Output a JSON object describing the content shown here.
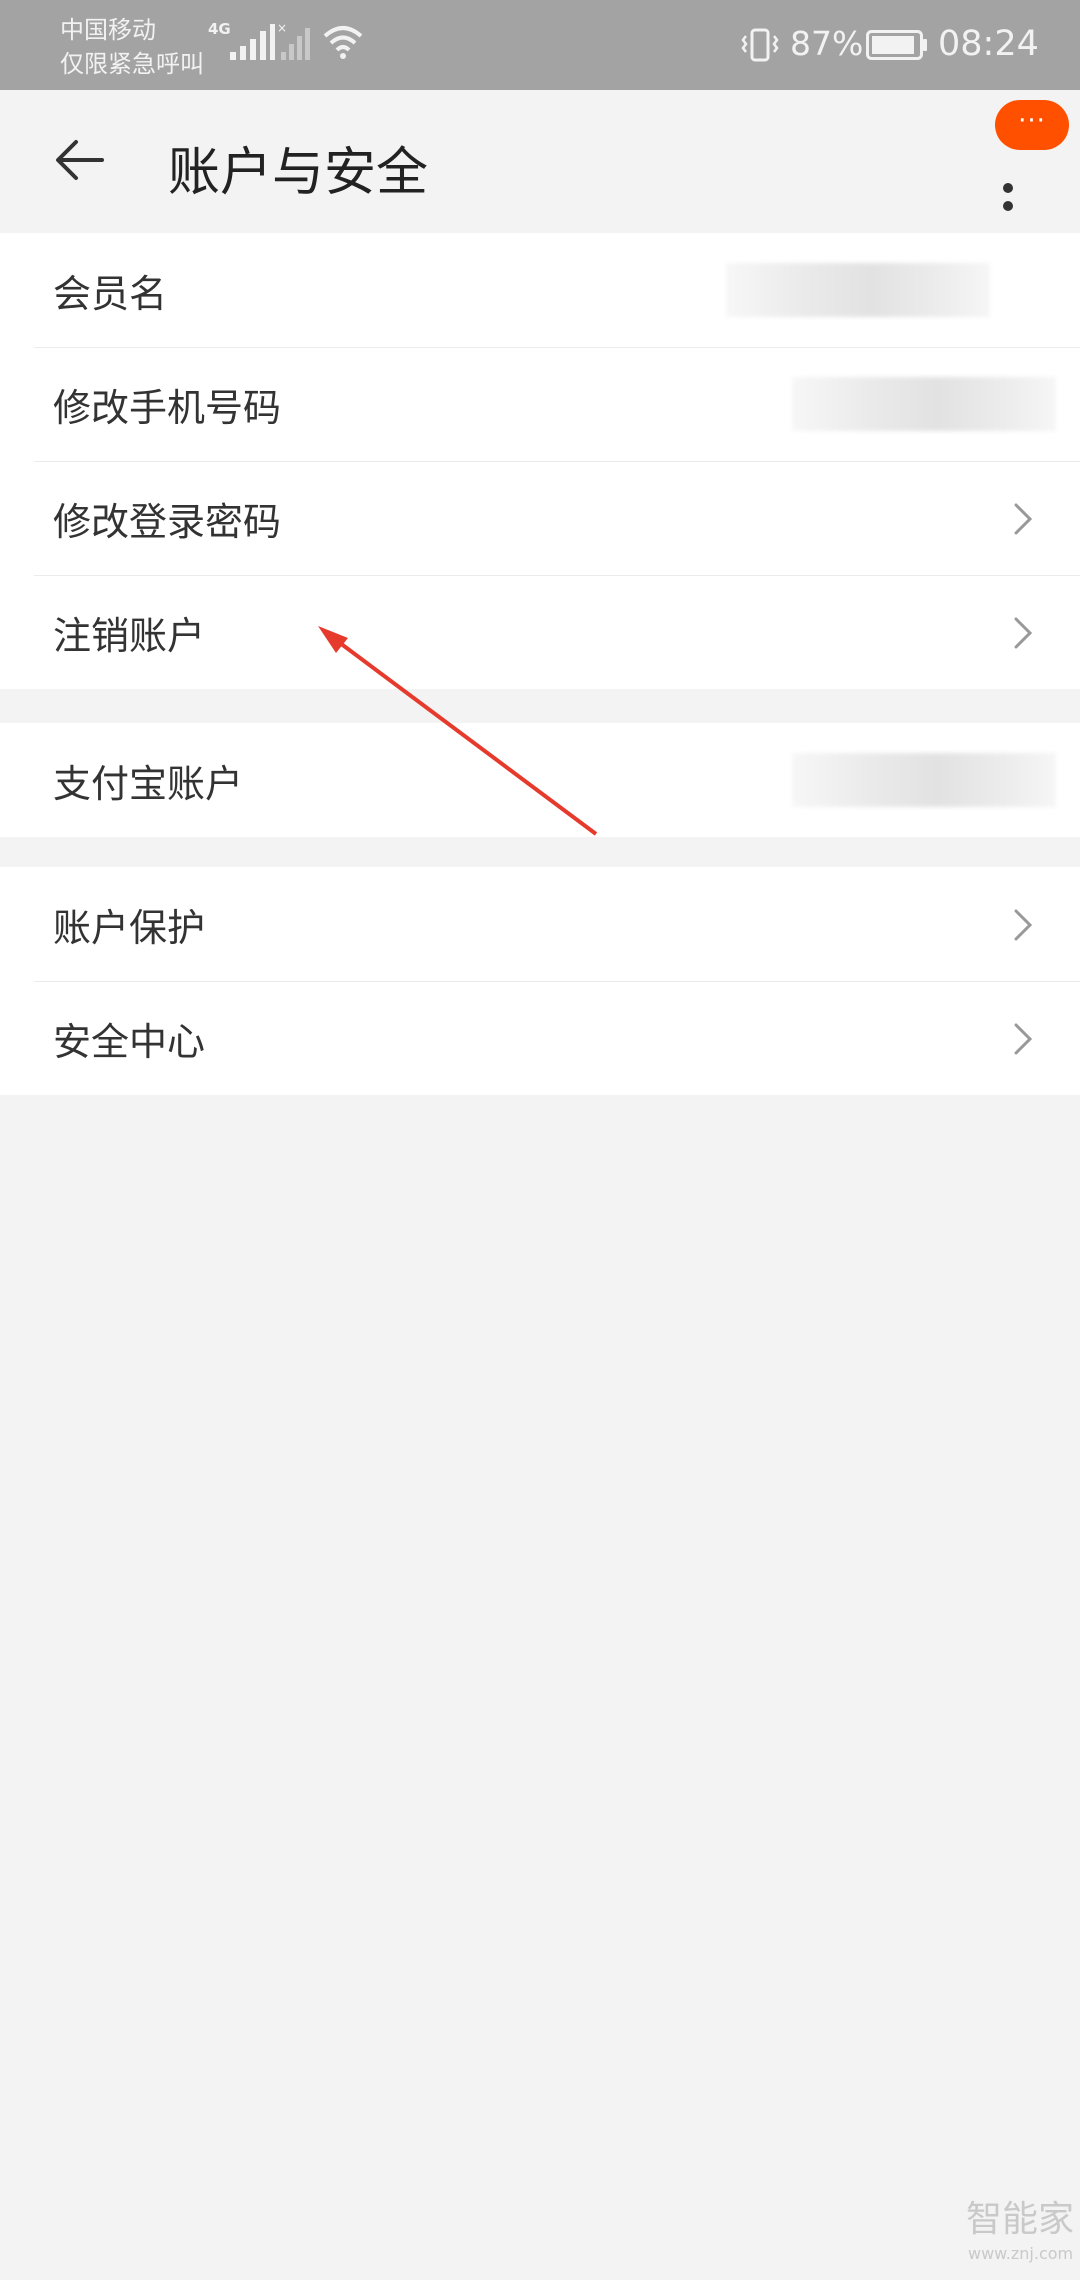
{
  "status_bar": {
    "carrier": "中国移动",
    "carrier_status": "仅限紧急呼叫",
    "network": "4G",
    "battery": "87%",
    "time": "08:24"
  },
  "header": {
    "title": "账户与安全",
    "badge_text": "···"
  },
  "groups": [
    {
      "items": [
        {
          "label": "会员名",
          "value_blurred": true,
          "chevron": false
        },
        {
          "label": "修改手机号码",
          "value_blurred": true,
          "chevron": false
        },
        {
          "label": "修改登录密码",
          "chevron": true
        },
        {
          "label": "注销账户",
          "chevron": true
        }
      ]
    },
    {
      "items": [
        {
          "label": "支付宝账户",
          "value_blurred": true,
          "chevron": false
        }
      ]
    },
    {
      "items": [
        {
          "label": "账户保护",
          "chevron": true
        },
        {
          "label": "安全中心",
          "chevron": true
        }
      ]
    }
  ],
  "annotation": {
    "color": "#e53a2c",
    "target": "注销账户"
  },
  "watermark": {
    "text": "智能家",
    "sub": "www.znj.com"
  },
  "colors": {
    "accent": "#ff5000",
    "status_bar_bg": "#a3a3a3",
    "page_bg": "#f3f3f3"
  }
}
